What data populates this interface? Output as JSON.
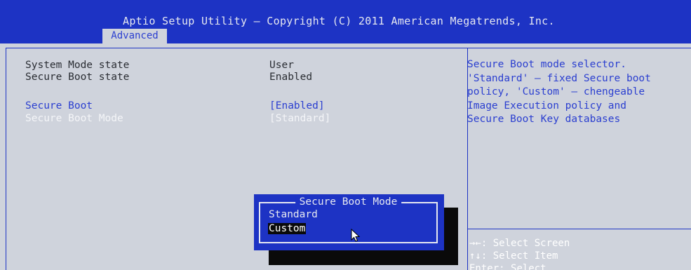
{
  "header": {
    "title": "Aptio Setup Utility – Copyright (C) 2011 American Megatrends, Inc.",
    "active_tab": "Advanced"
  },
  "main": {
    "info_rows": [
      {
        "label": "System Mode state",
        "value": "User"
      },
      {
        "label": "Secure Boot state",
        "value": "Enabled"
      }
    ],
    "settings": [
      {
        "label": "Secure Boot",
        "value": "[Enabled]"
      },
      {
        "label": "Secure Boot Mode",
        "value": "[Standard]"
      }
    ]
  },
  "help": {
    "lines": [
      "Secure Boot mode selector.",
      "'Standard' – fixed Secure boot",
      "policy, 'Custom' – chengeable",
      "Image Execution policy and",
      "Secure Boot Key databases"
    ],
    "keys": [
      {
        "key": "→←",
        "action": "Select Screen"
      },
      {
        "key": "↑↓",
        "action": "Select Item"
      },
      {
        "key": "Enter",
        "action": "Select"
      }
    ]
  },
  "popup": {
    "title": "Secure Boot Mode",
    "options": [
      "Standard",
      "Custom"
    ],
    "selected": "Custom"
  },
  "colors": {
    "header_blue": "#1d33c4",
    "panel_bg": "#cfd3dc",
    "text_blue": "#2b3fd0"
  }
}
